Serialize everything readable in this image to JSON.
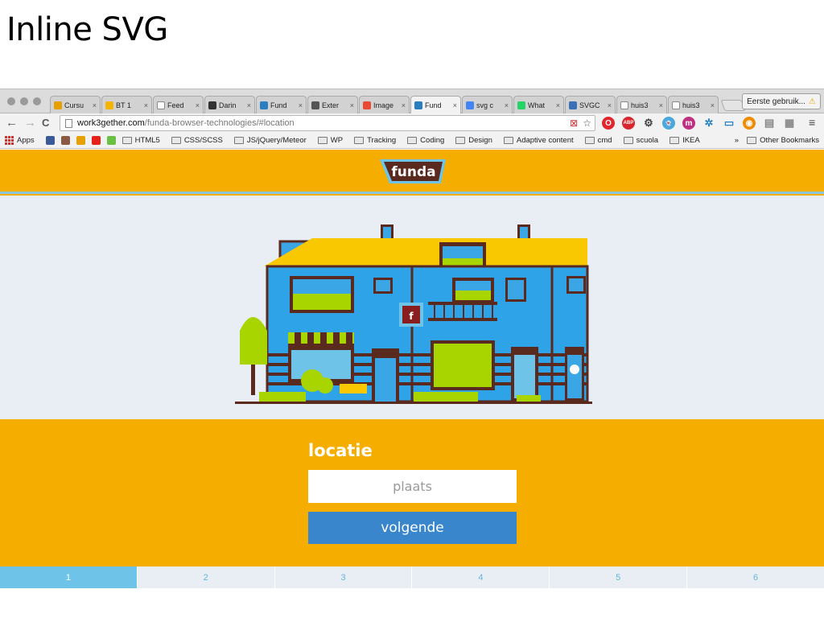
{
  "slide": {
    "title": "Inline SVG"
  },
  "browser": {
    "tabs": [
      {
        "label": "Cursu",
        "icon": "funda-icon",
        "color": "#e8a000"
      },
      {
        "label": "BT 1",
        "icon": "slides-icon",
        "color": "#f4b400"
      },
      {
        "label": "Feed",
        "icon": "document-icon",
        "color": "#ffffff"
      },
      {
        "label": "Darin",
        "icon": "github-icon",
        "color": "#333333"
      },
      {
        "label": "Fund",
        "icon": "funda-icon",
        "color": "#2a7fc1"
      },
      {
        "label": "Exter",
        "icon": "puzzle-icon",
        "color": "#555555"
      },
      {
        "label": "Image",
        "icon": "image-icon",
        "color": "#e94a35"
      },
      {
        "label": "Fund",
        "icon": "funda-icon",
        "color": "#2a7fc1",
        "active": true
      },
      {
        "label": "svg c",
        "icon": "google-icon",
        "color": "#4285f4"
      },
      {
        "label": "What",
        "icon": "whatsapp-icon",
        "color": "#25d366"
      },
      {
        "label": "SVGC",
        "icon": "globe-icon",
        "color": "#3b6fb6"
      },
      {
        "label": "huis3",
        "icon": "document-icon",
        "color": "#ffffff"
      },
      {
        "label": "huis3",
        "icon": "document-icon",
        "color": "#ffffff"
      }
    ],
    "tab_close": "×",
    "user": {
      "label": "Eerste gebruik...",
      "warning_icon": "warning-icon"
    },
    "nav": {
      "back": "←",
      "forward": "→",
      "reload": "C"
    },
    "address": {
      "host": "work3gether.com",
      "path": "/funda-browser-technologies/#location"
    },
    "extensions": [
      {
        "name": "opera-icon",
        "glyph": "O",
        "color": "#e3262e"
      },
      {
        "name": "adblock-icon",
        "glyph": "ABP",
        "color": "#d8262e"
      },
      {
        "name": "gear-icon",
        "glyph": "⚙",
        "color": "#444444"
      },
      {
        "name": "ghostery-icon",
        "glyph": "👻",
        "color": "#4aa7e0"
      },
      {
        "name": "m-icon",
        "glyph": "m",
        "color": "#c03080"
      },
      {
        "name": "network-icon",
        "glyph": "✲",
        "color": "#2b82c4"
      },
      {
        "name": "screenshot-icon",
        "glyph": "▭",
        "color": "#2b82c4"
      },
      {
        "name": "colorzilla-icon",
        "glyph": "◉",
        "color": "#f08c00"
      },
      {
        "name": "layers-icon",
        "glyph": "▤",
        "color": "#888888"
      },
      {
        "name": "css-icon",
        "glyph": "▦",
        "color": "#888888"
      }
    ],
    "menu_glyph": "≡",
    "bookmarks": [
      {
        "label": "Apps",
        "type": "apps"
      },
      {
        "label": "",
        "type": "fav",
        "color": "#3b5998",
        "name": "facebook-icon"
      },
      {
        "label": "",
        "type": "fav",
        "color": "#8a5a44",
        "name": "instagram-icon"
      },
      {
        "label": "",
        "type": "fav",
        "color": "#e8a000",
        "name": "funda-icon"
      },
      {
        "label": "",
        "type": "fav",
        "color": "#e62117",
        "name": "youtube-icon"
      },
      {
        "label": "",
        "type": "fav",
        "color": "#6ac045",
        "name": "refresh-icon"
      },
      {
        "label": "HTML5",
        "type": "folder"
      },
      {
        "label": "CSS/SCSS",
        "type": "folder"
      },
      {
        "label": "JS/jQuery/Meteor",
        "type": "folder"
      },
      {
        "label": "WP",
        "type": "folder"
      },
      {
        "label": "Tracking",
        "type": "folder"
      },
      {
        "label": "Coding",
        "type": "folder"
      },
      {
        "label": "Design",
        "type": "folder"
      },
      {
        "label": "Adaptive content",
        "type": "folder"
      },
      {
        "label": "cmd",
        "type": "folder"
      },
      {
        "label": "scuola",
        "type": "folder"
      },
      {
        "label": "IKEA",
        "type": "folder"
      }
    ],
    "bookmarks_more": "»",
    "other_bookmarks": "Other Bookmarks"
  },
  "app": {
    "logo_text": "funda",
    "sign_letter": "f",
    "form": {
      "heading": "locatie",
      "placeholder": "plaats",
      "button": "volgende"
    },
    "steps": [
      "1",
      "2",
      "3",
      "4",
      "5",
      "6"
    ],
    "active_step": 0,
    "colors": {
      "brand": "#f5ae00",
      "button": "#3a86cc",
      "step_active": "#6ec4e8",
      "logo": "#5b2a1f"
    }
  }
}
